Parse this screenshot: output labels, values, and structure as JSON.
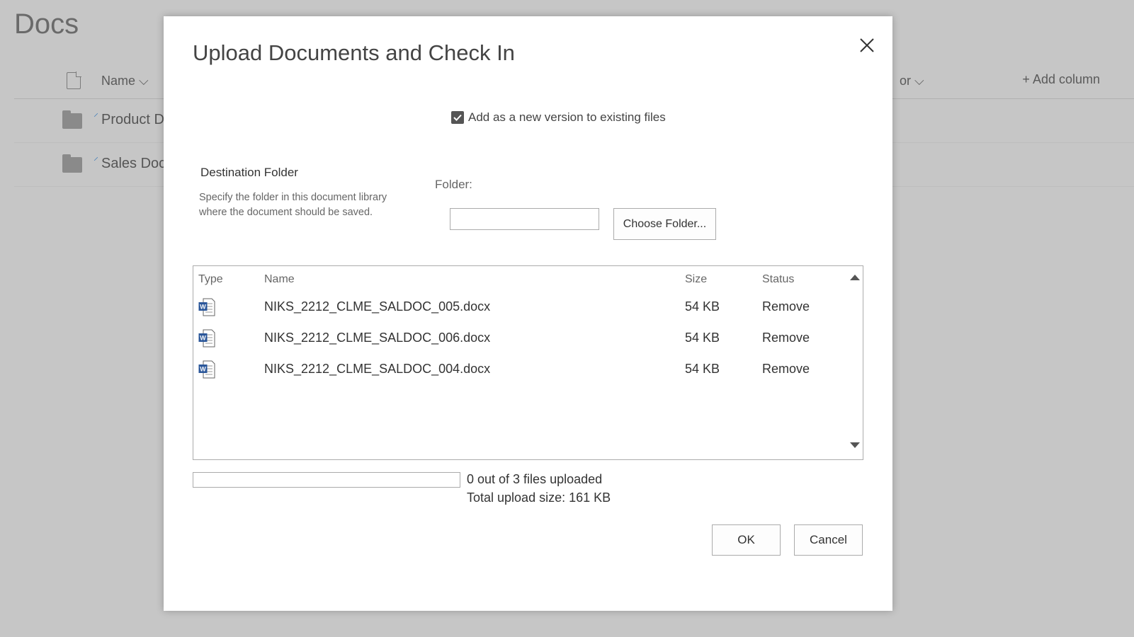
{
  "background": {
    "page_title": "Docs",
    "columns": {
      "name": "Name",
      "editor_partial": "or",
      "add_column": "Add column"
    },
    "rows": [
      {
        "label": "Product D"
      },
      {
        "label": "Sales Doc"
      }
    ]
  },
  "dialog": {
    "title": "Upload Documents and Check In",
    "version_checkbox": {
      "label": "Add as a new version to existing files",
      "checked": true
    },
    "destination": {
      "title": "Destination Folder",
      "description": "Specify the folder in this document library where the document should be saved.",
      "folder_label": "Folder:",
      "folder_value": "",
      "choose_button": "Choose Folder..."
    },
    "table": {
      "headers": {
        "type": "Type",
        "name": "Name",
        "size": "Size",
        "status": "Status"
      },
      "files": [
        {
          "icon": "word-doc-icon",
          "name": "NIKS_2212_CLME_SALDOC_005.docx",
          "size": "54 KB",
          "status": "Remove"
        },
        {
          "icon": "word-doc-icon",
          "name": "NIKS_2212_CLME_SALDOC_006.docx",
          "size": "54 KB",
          "status": "Remove"
        },
        {
          "icon": "word-doc-icon",
          "name": "NIKS_2212_CLME_SALDOC_004.docx",
          "size": "54 KB",
          "status": "Remove"
        }
      ]
    },
    "progress": {
      "fraction": 0,
      "status_text": "0 out of 3 files uploaded",
      "total_text": "Total upload size: 161 KB"
    },
    "buttons": {
      "ok": "OK",
      "cancel": "Cancel"
    }
  },
  "colors": {
    "overlay": "#c6c6c6",
    "accent": "#2b579a",
    "checkbox": "#555555"
  }
}
